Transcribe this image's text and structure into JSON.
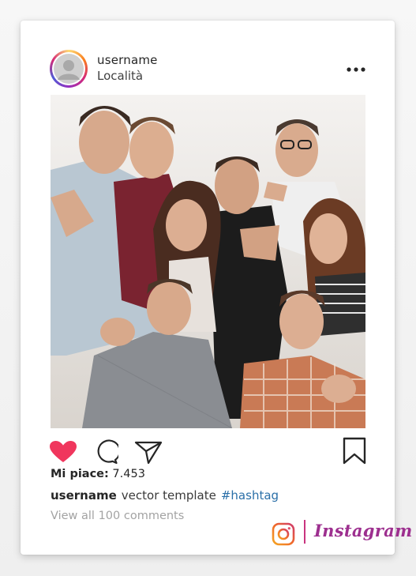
{
  "post": {
    "username": "username",
    "location": "Località",
    "photo_alt": "",
    "likes_label": "Mi piace:",
    "likes_count": "7.453",
    "caption_user": "username",
    "caption_text": "vector template",
    "caption_hashtag": "#hashtag",
    "view_comments": "View all 100 comments"
  },
  "brand": {
    "wordmark": "Instagram"
  },
  "icons": {
    "more": "more-options-icon",
    "like": "heart-icon",
    "comment": "comment-icon",
    "share": "share-icon",
    "save": "bookmark-icon",
    "brand": "instagram-logo-icon"
  },
  "colors": {
    "like": "#f0365d",
    "hashtag": "#2a6fa8",
    "brand_purple": "#9d2f8f",
    "brand_orange": "#f06a2a"
  }
}
